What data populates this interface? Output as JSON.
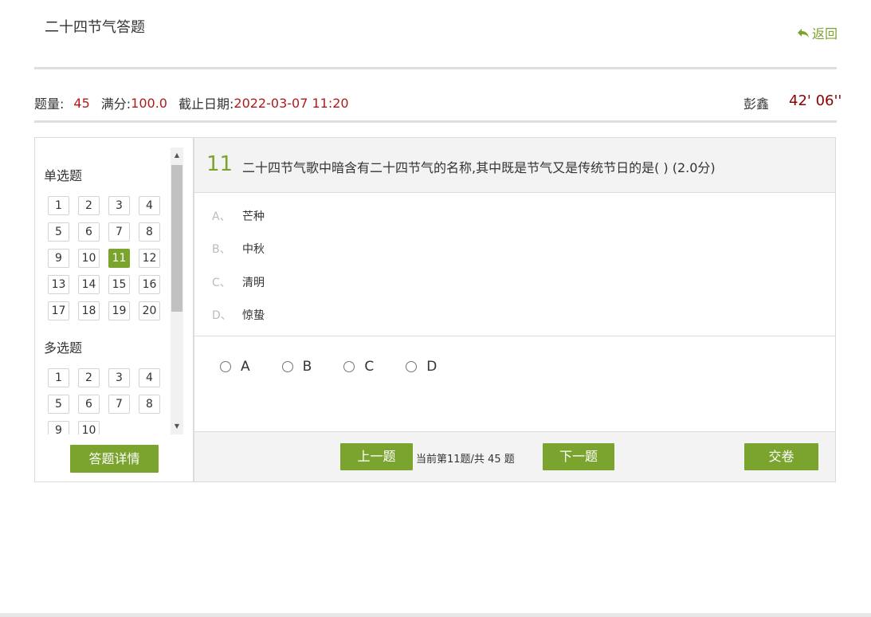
{
  "header": {
    "title": "二十四节气答题",
    "back_label": "返回",
    "back_icon": "reply-arrow-icon",
    "accent_color": "#7ba42f"
  },
  "info": {
    "count_label": "题量:",
    "count_value": "45",
    "full_label": "满分:",
    "full_value": "100.0",
    "deadline_label": "截止日期:",
    "deadline_value": "2022-03-07 11:20",
    "user": "彭鑫",
    "timer": "42' 06''"
  },
  "nav": {
    "single_title": "单选题",
    "single_items": [
      "1",
      "2",
      "3",
      "4",
      "5",
      "6",
      "7",
      "8",
      "9",
      "10",
      "11",
      "12",
      "13",
      "14",
      "15",
      "16",
      "17",
      "18",
      "19",
      "20"
    ],
    "multi_title": "多选题",
    "multi_items": [
      "1",
      "2",
      "3",
      "4",
      "5",
      "6",
      "7",
      "8",
      "9",
      "10"
    ],
    "active_item": "11",
    "detail_button": "答题详情"
  },
  "question": {
    "number": "11",
    "text": "二十四节气歌中暗含有二十四节气的名称,其中既是节气又是传统节日的是( ) (2.0分)",
    "options": [
      {
        "letter": "A、",
        "text": "芒种"
      },
      {
        "letter": "B、",
        "text": "中秋"
      },
      {
        "letter": "C、",
        "text": "清明"
      },
      {
        "letter": "D、",
        "text": "惊蛰"
      }
    ],
    "answers": [
      "A",
      "B",
      "C",
      "D"
    ]
  },
  "footer": {
    "prev_label": "上一题",
    "current_text": "当前第11题/共 45 题",
    "next_label": "下一题",
    "submit_label": "交卷"
  }
}
